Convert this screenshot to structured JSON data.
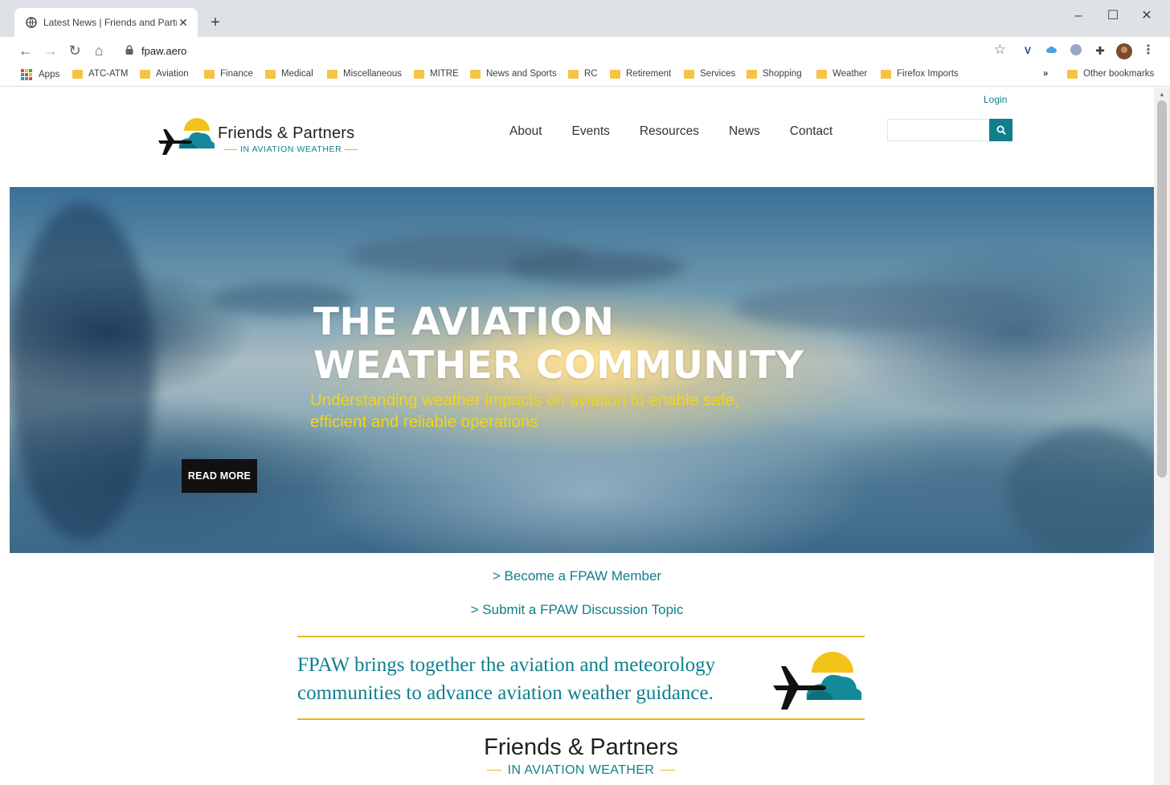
{
  "browser": {
    "tab_title": "Latest News | Friends and Partne",
    "url": "fpaw.aero",
    "bookmarks": [
      "Apps",
      "ATC-ATM",
      "Aviation",
      "Finance",
      "Medical",
      "Miscellaneous",
      "MITRE",
      "News and Sports",
      "RC",
      "Retirement",
      "Services",
      "Shopping",
      "Weather",
      "Firefox Imports"
    ],
    "overflow": "»",
    "other_bookmarks": "Other bookmarks"
  },
  "site": {
    "login": "Login",
    "brand": "Friends & Partners",
    "brand_sub": "IN AVIATION WEATHER",
    "nav": [
      "About",
      "Events",
      "Resources",
      "News",
      "Contact"
    ],
    "search_placeholder": ""
  },
  "hero": {
    "title_line1": "THE AVIATION",
    "title_line2": "WEATHER COMMUNITY",
    "tagline_line1": "Understanding weather impacts on aviation to enable safe,",
    "tagline_line2": "efficient and reliable operations",
    "read_more": "READ MORE"
  },
  "cta": {
    "member": "> Become a FPAW Member",
    "topic": "> Submit a FPAW Discussion Topic"
  },
  "mission": {
    "line1": "FPAW brings together the aviation and meteorology",
    "line2": "communities to advance aviation weather guidance."
  },
  "footer_logo": {
    "brand": "Friends & Partners",
    "sub": "IN AVIATION WEATHER"
  },
  "colors": {
    "teal": "#0f7f8c",
    "gold": "#e8b913",
    "tagline_yellow": "#f0d51a"
  }
}
